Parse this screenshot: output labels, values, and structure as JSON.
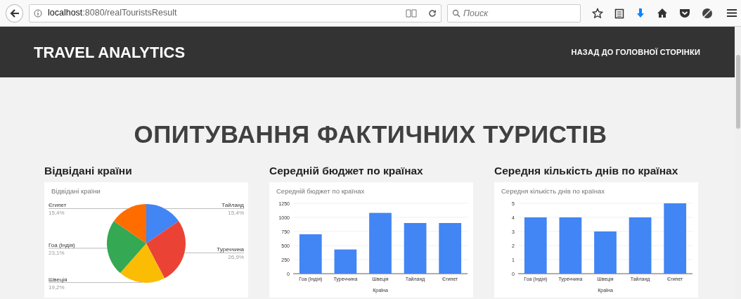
{
  "browser": {
    "url_host": "localhost",
    "url_rest": ":8080/realTouristsResult",
    "search_placeholder": "Поиск"
  },
  "navbar": {
    "brand": "TRAVEL ANALYTICS",
    "link": "НАЗАД ДО ГОЛОВНОЇ СТОРІНКИ"
  },
  "heading": "ОПИТУВАННЯ ФАКТИЧНИХ ТУРИСТІВ",
  "sections": [
    {
      "title": "Відвідані країни",
      "chart_data": {
        "type": "pie",
        "title": "Відвідані країни",
        "categories": [
          "Тайланд",
          "Туреччина",
          "Швеція",
          "Гоа (Індія)",
          "Єгипет"
        ],
        "values": [
          15.4,
          26.9,
          19.2,
          23.1,
          15.4
        ],
        "colors": [
          "#4285f4",
          "#ea4335",
          "#fbbc04",
          "#34a853",
          "#ff6d01"
        ],
        "value_labels": [
          "15,4%",
          "26,9%",
          "19,2%",
          "23,1%",
          "15,4%"
        ]
      }
    },
    {
      "title": "Середній бюджет по країнах",
      "chart_data": {
        "type": "bar",
        "title": "Середній бюджет по країнах",
        "xlabel": "Країна",
        "categories": [
          "Гоа (Індія)",
          "Туреччина",
          "Швеція",
          "Тайланд",
          "Єгипет"
        ],
        "series": [
          {
            "color": "#4285f4",
            "values": [
              700,
              430,
              1080,
              900,
              900
            ]
          }
        ],
        "grid": true,
        "ylim": [
          0,
          1250
        ],
        "yticks": [
          0,
          250,
          500,
          750,
          1000,
          1250
        ]
      }
    },
    {
      "title": "Середня кількість днів по країнах",
      "chart_data": {
        "type": "bar",
        "title": "Середня кількість днів по країнах",
        "xlabel": "Країна",
        "categories": [
          "Гоа (Індія)",
          "Туреччина",
          "Швеція",
          "Тайланд",
          "Єгипет"
        ],
        "series": [
          {
            "color": "#4285f4",
            "values": [
              4,
              4,
              3,
              4,
              5
            ]
          }
        ],
        "grid": true,
        "ylim": [
          0,
          5
        ],
        "yticks": [
          0,
          1,
          2,
          3,
          4,
          5
        ]
      }
    }
  ]
}
